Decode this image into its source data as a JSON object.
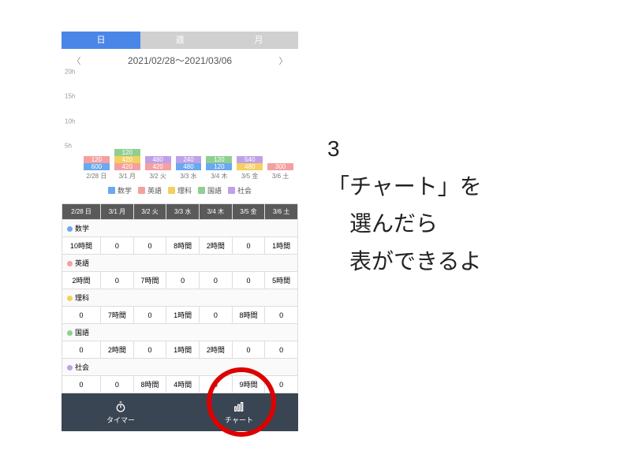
{
  "tabs": {
    "day": "日",
    "week": "週",
    "month": "月"
  },
  "date_range": "2021/02/28～2021/03/06",
  "subjects": {
    "math": {
      "name": "数学",
      "color": "#6aa8f0"
    },
    "eng": {
      "name": "英語",
      "color": "#f5a0a0"
    },
    "sci": {
      "name": "理科",
      "color": "#f5d060"
    },
    "jap": {
      "name": "国語",
      "color": "#8fd090"
    },
    "soc": {
      "name": "社会",
      "color": "#c0a0e8"
    }
  },
  "chart_data": {
    "type": "bar",
    "categories": [
      "2/28 日",
      "3/1 月",
      "3/2 火",
      "3/3 水",
      "3/4 木",
      "3/5 金",
      "3/6 土"
    ],
    "unit": "minutes",
    "series": [
      {
        "name": "数学",
        "color": "#6aa8f0",
        "values": [
          600,
          0,
          0,
          480,
          120,
          0,
          60
        ]
      },
      {
        "name": "英語",
        "color": "#f5a0a0",
        "values": [
          120,
          420,
          420,
          0,
          0,
          0,
          300
        ]
      },
      {
        "name": "理科",
        "color": "#f5d060",
        "values": [
          0,
          420,
          0,
          60,
          0,
          480,
          0
        ]
      },
      {
        "name": "国語",
        "color": "#8fd090",
        "values": [
          0,
          120,
          0,
          60,
          120,
          0,
          0
        ]
      },
      {
        "name": "社会",
        "color": "#c0a0e8",
        "values": [
          0,
          0,
          480,
          240,
          0,
          540,
          0
        ]
      }
    ],
    "ylabel": "h",
    "ylim_hours": [
      0,
      20
    ],
    "yticks": [
      "5h",
      "10h",
      "15h",
      "20h"
    ],
    "data_labels_shown": [
      600,
      120,
      420,
      120,
      420,
      480,
      480,
      240,
      120,
      120,
      480,
      540,
      300
    ]
  },
  "table": {
    "headers": [
      "2/28 日",
      "3/1 月",
      "3/2 火",
      "3/3 水",
      "3/4 木",
      "3/5 金",
      "3/6 土"
    ],
    "rows": [
      {
        "subj": "math",
        "cells": [
          "10時間",
          "0",
          "0",
          "8時間",
          "2時間",
          "0",
          "1時間"
        ]
      },
      {
        "subj": "eng",
        "cells": [
          "2時間",
          "0",
          "7時間",
          "0",
          "0",
          "0",
          "5時間"
        ]
      },
      {
        "subj": "sci",
        "cells": [
          "0",
          "7時間",
          "0",
          "1時間",
          "0",
          "8時間",
          "0"
        ]
      },
      {
        "subj": "jap",
        "cells": [
          "0",
          "2時間",
          "0",
          "1時間",
          "2時間",
          "0",
          "0"
        ]
      },
      {
        "subj": "soc",
        "cells": [
          "0",
          "0",
          "8時間",
          "4時間",
          "0",
          "9時間",
          "0"
        ]
      }
    ]
  },
  "bottom": {
    "timer": "タイマー",
    "chart": "チャート"
  },
  "instruction": {
    "num": "3",
    "line1": "「チャート」を",
    "line2": "　選んだら",
    "line3": "　表ができるよ"
  }
}
